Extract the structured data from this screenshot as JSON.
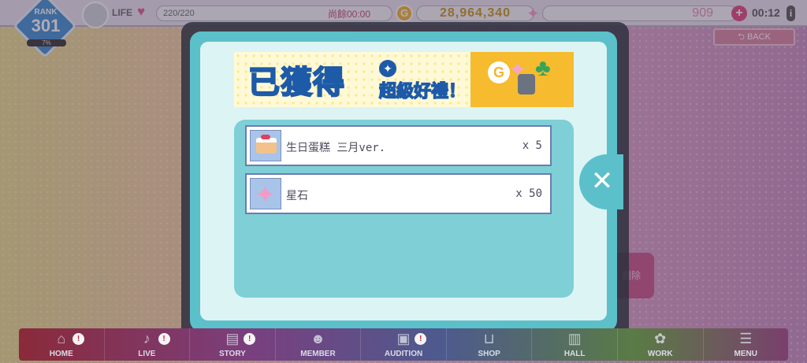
{
  "topbar": {
    "rank_label": "RANK",
    "rank_value": "301",
    "rank_progress": "7%",
    "life_label": "LIFE",
    "life_value": "220/220",
    "recover_text": "尚餘00:00",
    "coin_symbol": "G",
    "coins": "28,964,340",
    "stars": "909",
    "clock": "00:12",
    "info_symbol": "i"
  },
  "back_label": "BACK",
  "delete_label": "刪除",
  "modal": {
    "banner_title": "已獲得",
    "banner_subtitle": "超級好禮！",
    "items": [
      {
        "name": "生日蛋糕 三月ver.",
        "qty": "x 5",
        "icon": "cake-icon"
      },
      {
        "name": "星石",
        "qty": "x 50",
        "icon": "star-stone-icon"
      }
    ],
    "close_symbol": "✕"
  },
  "nav": [
    {
      "label": "HOME",
      "icon": "home-icon",
      "badge": "!"
    },
    {
      "label": "LIVE",
      "icon": "music-icon",
      "badge": "!"
    },
    {
      "label": "STORY",
      "icon": "book-icon",
      "badge": "!"
    },
    {
      "label": "MEMBER",
      "icon": "member-icon",
      "badge": ""
    },
    {
      "label": "AUDITION",
      "icon": "audition-icon",
      "badge": "!"
    },
    {
      "label": "SHOP",
      "icon": "basket-icon",
      "badge": ""
    },
    {
      "label": "HALL",
      "icon": "hall-icon",
      "badge": ""
    },
    {
      "label": "WORK",
      "icon": "work-icon",
      "badge": ""
    },
    {
      "label": "MENU",
      "icon": "menu-icon",
      "badge": ""
    }
  ]
}
